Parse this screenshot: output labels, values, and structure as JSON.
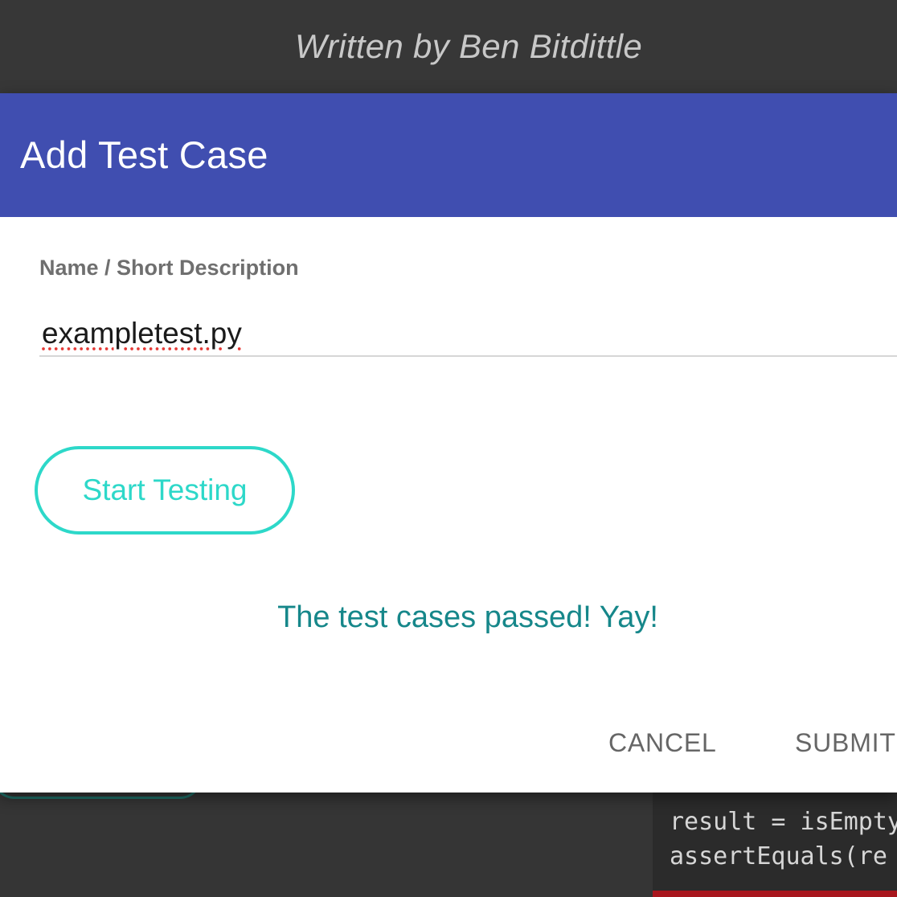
{
  "background": {
    "author_line": "Written by Ben Bitdittle",
    "code_lines": [
      "result = isEmpty",
      "assertEquals(re"
    ]
  },
  "dialog": {
    "title": "Add Test Case",
    "name_field": {
      "label": "Name / Short Description",
      "value": "exampletest.py",
      "placeholder": ""
    },
    "start_button_label": "Start Testing",
    "status_message": "The test cases passed! Yay!",
    "cancel_label": "CANCEL",
    "submit_label": "SUBMIT"
  },
  "colors": {
    "header": "#404eb0",
    "accent": "#2dd8c9",
    "success_text": "#16878a",
    "backdrop": "#353535"
  }
}
